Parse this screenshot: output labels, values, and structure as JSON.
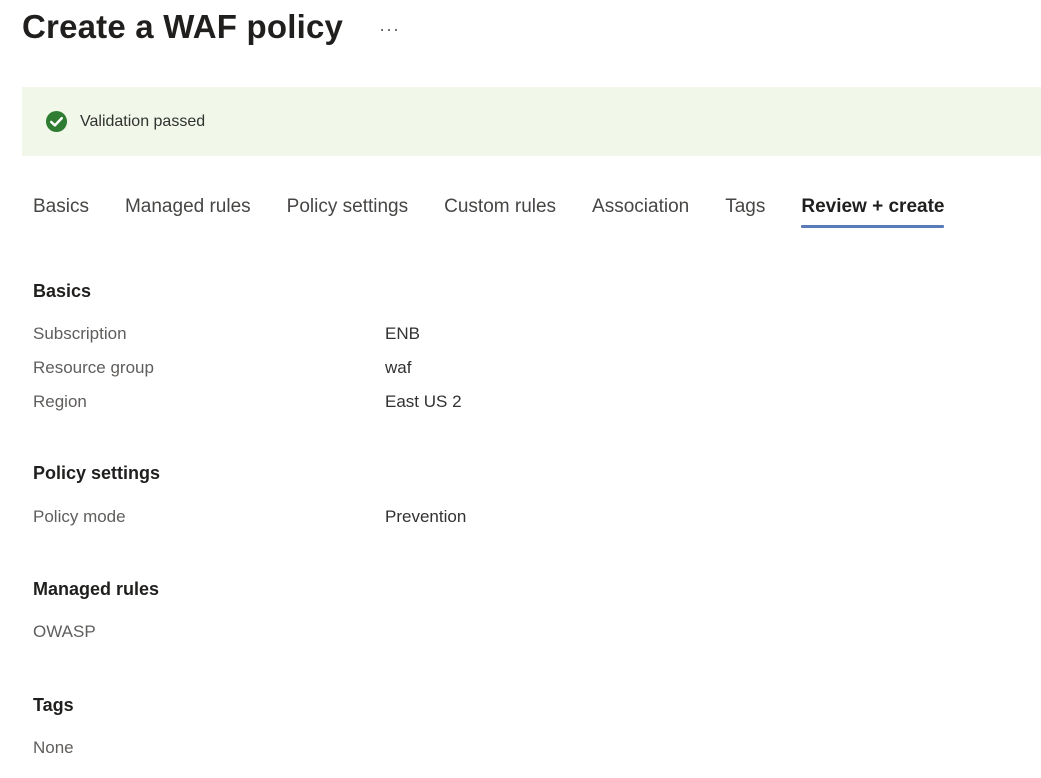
{
  "header": {
    "title": "Create a WAF policy",
    "more_label": "···"
  },
  "banner": {
    "icon": "check-circle-icon",
    "text": "Validation passed",
    "color": "#2e7d32"
  },
  "tabs": [
    {
      "label": "Basics",
      "active": false
    },
    {
      "label": "Managed rules",
      "active": false
    },
    {
      "label": "Policy settings",
      "active": false
    },
    {
      "label": "Custom rules",
      "active": false
    },
    {
      "label": "Association",
      "active": false
    },
    {
      "label": "Tags",
      "active": false
    },
    {
      "label": "Review + create",
      "active": true
    }
  ],
  "sections": {
    "basics": {
      "heading": "Basics",
      "fields": [
        {
          "label": "Subscription",
          "value": "ENB"
        },
        {
          "label": "Resource group",
          "value": "waf"
        },
        {
          "label": "Region",
          "value": "East US 2"
        }
      ]
    },
    "policy_settings": {
      "heading": "Policy settings",
      "fields": [
        {
          "label": "Policy mode",
          "value": "Prevention"
        }
      ]
    },
    "managed_rules": {
      "heading": "Managed rules",
      "value": "OWASP"
    },
    "tags": {
      "heading": "Tags",
      "value": "None"
    }
  },
  "colors": {
    "banner_background": "#f1f8e9",
    "active_tab_underline": "#5b7ab8"
  }
}
